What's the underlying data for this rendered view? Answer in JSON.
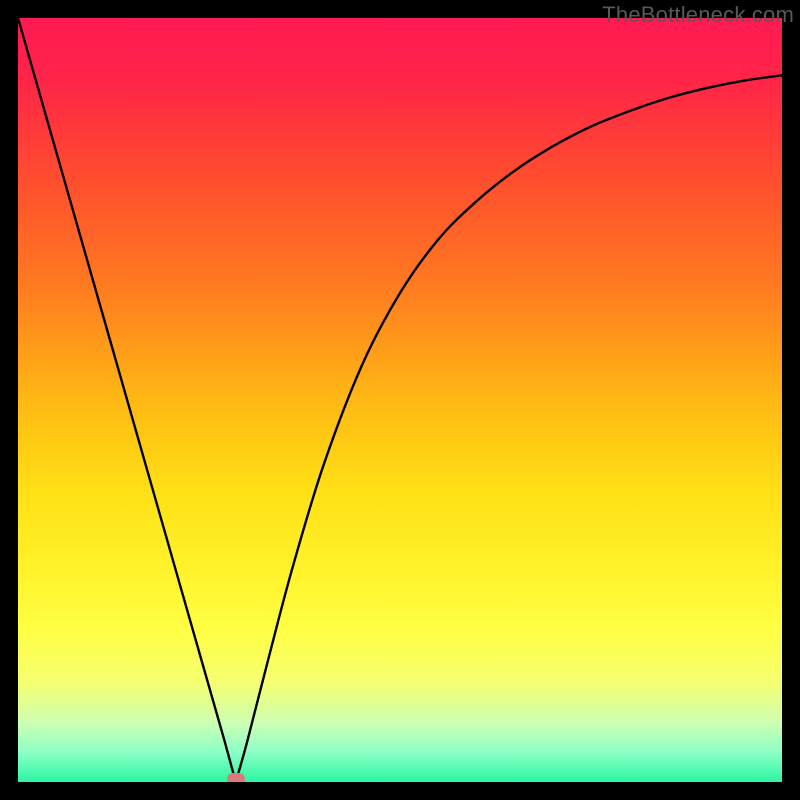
{
  "watermark": "TheBottleneck.com",
  "colors": {
    "frame": "#000000",
    "curve": "#000000",
    "marker": "#d87a7d",
    "gradient_stops": [
      {
        "offset": 0.0,
        "color": "#ff1a53"
      },
      {
        "offset": 0.08,
        "color": "#ff2448"
      },
      {
        "offset": 0.2,
        "color": "#ff4a30"
      },
      {
        "offset": 0.35,
        "color": "#ff7a20"
      },
      {
        "offset": 0.5,
        "color": "#ffb814"
      },
      {
        "offset": 0.62,
        "color": "#ffe015"
      },
      {
        "offset": 0.72,
        "color": "#fff22a"
      },
      {
        "offset": 0.8,
        "color": "#ffff44"
      },
      {
        "offset": 0.87,
        "color": "#f5ff70"
      },
      {
        "offset": 0.92,
        "color": "#cfffb0"
      },
      {
        "offset": 0.96,
        "color": "#8effc6"
      },
      {
        "offset": 1.0,
        "color": "#2bf6a3"
      }
    ]
  },
  "chart_data": {
    "type": "line",
    "title": "",
    "xlabel": "",
    "ylabel": "",
    "xlim": [
      0,
      1
    ],
    "ylim": [
      0,
      1
    ],
    "series": [
      {
        "name": "curve",
        "x": [
          0.0,
          0.03,
          0.06,
          0.09,
          0.12,
          0.15,
          0.18,
          0.21,
          0.24,
          0.27,
          0.285,
          0.3,
          0.33,
          0.36,
          0.4,
          0.45,
          0.5,
          0.55,
          0.6,
          0.65,
          0.7,
          0.75,
          0.8,
          0.85,
          0.9,
          0.95,
          1.0
        ],
        "y": [
          1.0,
          0.895,
          0.79,
          0.685,
          0.58,
          0.475,
          0.37,
          0.265,
          0.16,
          0.055,
          0.0,
          0.053,
          0.17,
          0.283,
          0.415,
          0.545,
          0.64,
          0.71,
          0.76,
          0.8,
          0.832,
          0.858,
          0.878,
          0.895,
          0.908,
          0.918,
          0.925
        ]
      }
    ],
    "marker": {
      "x": 0.285,
      "y": 0.0
    },
    "notes": "x,y are normalized fractions of the plot area; y is inverted (1 at top, 0 at bottom). The curve is a V-shape with minimum at x≈0.285 and a saturating right branch."
  }
}
